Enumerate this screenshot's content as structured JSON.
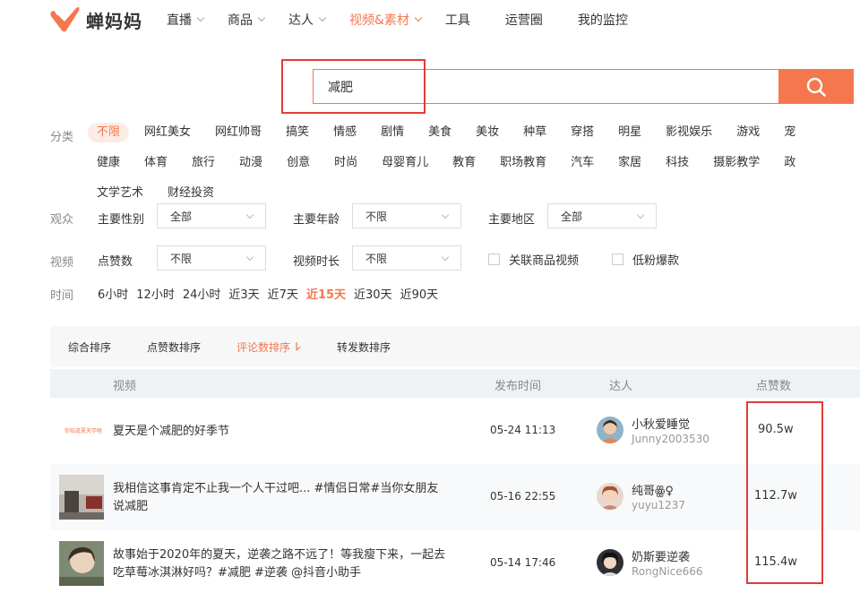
{
  "brand": {
    "name": "蝉妈妈",
    "accent": "#f4774e",
    "highlight": "#e23b3b"
  },
  "nav": [
    {
      "label": "直播",
      "dropdown": true,
      "active": false
    },
    {
      "label": "商品",
      "dropdown": true,
      "active": false
    },
    {
      "label": "达人",
      "dropdown": true,
      "active": false
    },
    {
      "label": "视频&素材",
      "dropdown": true,
      "active": true
    },
    {
      "label": "工具",
      "dropdown": false,
      "active": false
    },
    {
      "label": "运营圈",
      "dropdown": false,
      "active": false
    },
    {
      "label": "我的监控",
      "dropdown": false,
      "active": false
    }
  ],
  "search": {
    "value": "减肥",
    "button_icon": "search-icon"
  },
  "filters": {
    "category": {
      "label": "分类",
      "items": [
        "不限",
        "网红美女",
        "网红帅哥",
        "搞笑",
        "情感",
        "剧情",
        "美食",
        "美妆",
        "种草",
        "穿搭",
        "明星",
        "影视娱乐",
        "游戏",
        "宠",
        "健康",
        "体育",
        "旅行",
        "动漫",
        "创意",
        "时尚",
        "母婴育儿",
        "教育",
        "职场教育",
        "汽车",
        "家居",
        "科技",
        "摄影教学",
        "政",
        "文学艺术",
        "财经投资"
      ],
      "active_index": 0
    },
    "audience": {
      "label": "观众",
      "gender": {
        "label": "主要性别",
        "value": "全部"
      },
      "age": {
        "label": "主要年龄",
        "value": "不限"
      },
      "region": {
        "label": "主要地区",
        "value": "全部"
      }
    },
    "video": {
      "label": "视频",
      "likes": {
        "label": "点赞数",
        "value": "不限"
      },
      "duration": {
        "label": "视频时长",
        "value": "不限"
      },
      "linked_goods": {
        "label": "关联商品视频",
        "checked": false
      },
      "low_fans": {
        "label": "低粉爆款",
        "checked": false
      }
    },
    "time": {
      "label": "时间",
      "items": [
        "6小时",
        "12小时",
        "24小时",
        "近3天",
        "近7天",
        "近15天",
        "近30天",
        "近90天"
      ],
      "active_index": 5
    }
  },
  "sort": {
    "items": [
      "综合排序",
      "点赞数排序",
      "评论数排序",
      "转发数排序"
    ],
    "active_index": 2,
    "active_icon": "sort-down-icon"
  },
  "table": {
    "headers": {
      "video": "视频",
      "date": "发布时间",
      "author": "达人",
      "likes": "点赞数"
    },
    "rows": [
      {
        "title": "夏天是个减肥的好季节",
        "thumb_text": "你知道夏天学啥",
        "date": "05-24 11:13",
        "author": "小秋爱睡觉",
        "author_id": "Junny2003530",
        "likes": "90.5w"
      },
      {
        "title": "我相信这事肯定不止我一个人干过吧... #情侣日常#当你女朋友说减肥",
        "thumb_text": "",
        "date": "05-16 22:55",
        "author": "纯哥ꙮ♀",
        "author_id": "yuyu1237",
        "likes": "112.7w"
      },
      {
        "title": "故事始于2020年的夏天，逆袭之路不远了！等我瘦下来，一起去吃草莓冰淇淋好吗？#减肥 #逆袭 @抖音小助手",
        "thumb_text": "",
        "date": "05-14 17:46",
        "author": "奶斯要逆袭",
        "author_id": "RongNice666",
        "likes": "115.4w"
      }
    ]
  }
}
